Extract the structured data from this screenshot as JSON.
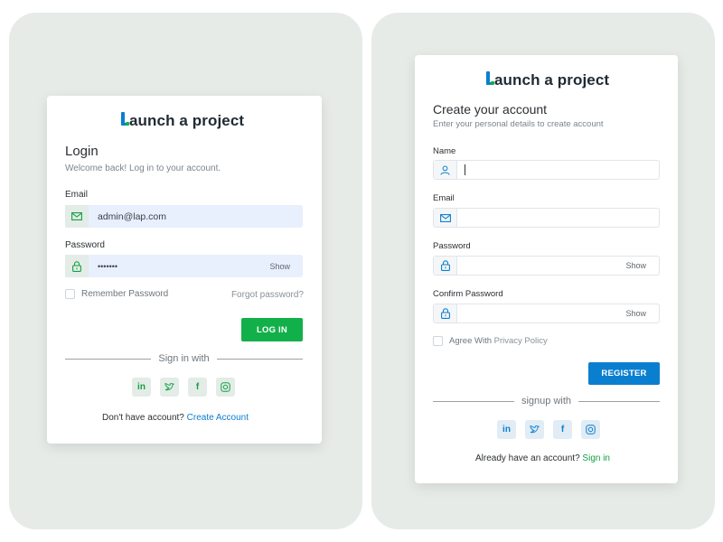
{
  "login": {
    "logo": "aunch a project",
    "title": "Login",
    "subtitle": "Welcome back! Log in to your account.",
    "email_label": "Email",
    "email_value": "admin@lap.com",
    "password_label": "Password",
    "password_value": "•••••••",
    "show_label": "Show",
    "remember_label": "Remember Password",
    "forgot_label": "Forgot password?",
    "login_button": "LOG IN",
    "signin_with": "Sign in with",
    "no_account": "Don't have account?",
    "create_account": "Create Account",
    "social_glyphs": [
      "in",
      "𝕥",
      "f",
      "◎"
    ]
  },
  "register": {
    "logo": "aunch a project",
    "title": "Create your account",
    "subtitle": "Enter your personal details to create account",
    "name_label": "Name",
    "email_label": "Email",
    "password_label": "Password",
    "confirm_label": "Confirm Password",
    "show_label": "Show",
    "agree_label": "Agree With",
    "privacy_label": "Privacy Policy",
    "register_button": "REGISTER",
    "signup_with": "signup with",
    "have_account": "Already have an account?",
    "sign_in": "Sign in",
    "social_glyphs": [
      "in",
      "𝕥",
      "f",
      "◎"
    ]
  },
  "colors": {
    "brand_blue": "#0b7fcf",
    "brand_green": "#12b04a",
    "panel_bg": "#e6ebe8"
  }
}
